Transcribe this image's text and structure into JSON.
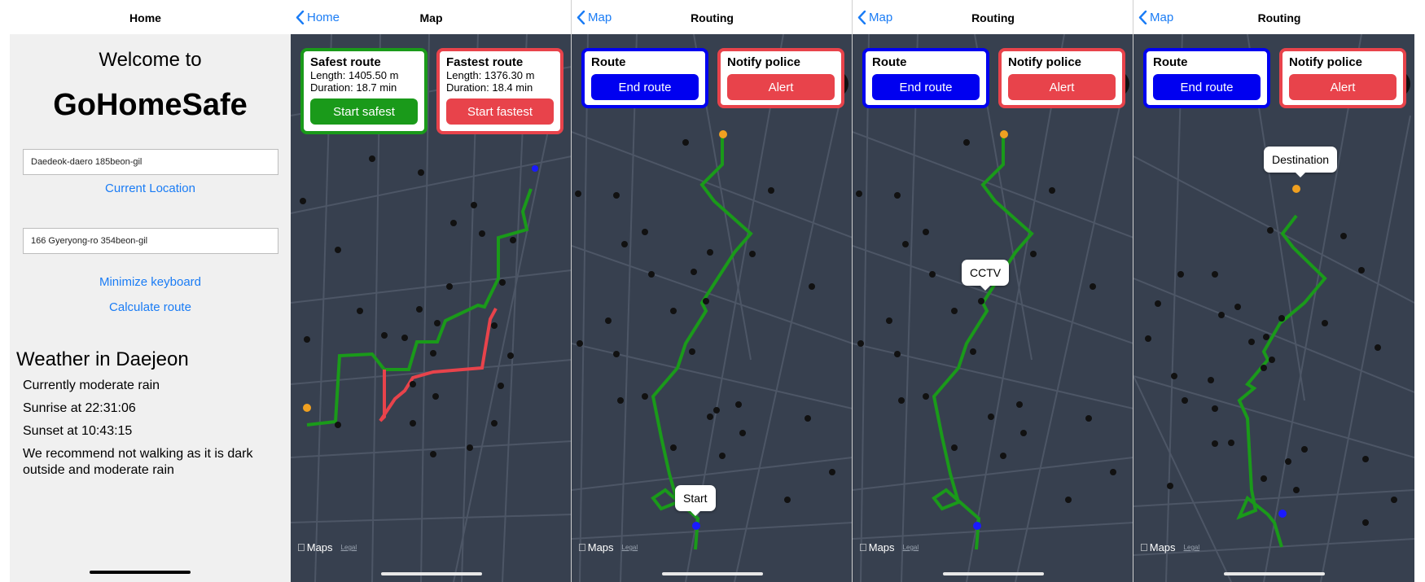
{
  "home": {
    "nav_title": "Home",
    "welcome": "Welcome to",
    "app_name": "GoHomeSafe",
    "start_address": "Daedeok-daero 185beon-gil",
    "current_location": "Current Location",
    "dest_address": "166 Gyeryong-ro 354beon-gil",
    "minimize_keyboard": "Minimize keyboard",
    "calculate_route": "Calculate route",
    "weather_title": "Weather in Daejeon",
    "weather_now": "Currently moderate rain",
    "sunrise": "Sunrise at 22:31:06",
    "sunset": "Sunset at 10:43:15",
    "recommendation": "We recommend not walking as it is dark outside and moderate rain"
  },
  "map_screen": {
    "back_label": "Home",
    "nav_title": "Map",
    "safest": {
      "title": "Safest route",
      "length": "Length: 1405.50 m",
      "duration": "Duration: 18.7 min",
      "button": "Start safest"
    },
    "fastest": {
      "title": "Fastest route",
      "length": "Length: 1376.30 m",
      "duration": "Duration: 18.4 min",
      "button": "Start fastest"
    },
    "attribution": "Maps",
    "legal": "Legal"
  },
  "routing_screens": [
    {
      "back_label": "Map",
      "nav_title": "Routing",
      "route_title": "Route",
      "route_button": "End route",
      "notify_title": "Notify police",
      "notify_button": "Alert",
      "attribution": "Maps",
      "legal": "Legal",
      "callout": "Start"
    },
    {
      "back_label": "Map",
      "nav_title": "Routing",
      "route_title": "Route",
      "route_button": "End route",
      "notify_title": "Notify police",
      "notify_button": "Alert",
      "attribution": "Maps",
      "legal": "Legal",
      "callout": "CCTV"
    },
    {
      "back_label": "Map",
      "nav_title": "Routing",
      "route_title": "Route",
      "route_button": "End route",
      "notify_title": "Notify police",
      "notify_button": "Alert",
      "attribution": "Maps",
      "legal": "Legal",
      "callout": "Destination"
    }
  ],
  "colors": {
    "link_blue": "#1a7cf5",
    "map_bg": "#37404f",
    "safe_green": "#1a9a1a",
    "fast_red": "#e8434b",
    "route_blue": "#0000f0"
  },
  "icons": [
    "chevron-left-icon",
    "cctv-pin-icon",
    "destination-pin-icon",
    "current-location-icon",
    "apple-logo-icon",
    "compass-icon"
  ]
}
